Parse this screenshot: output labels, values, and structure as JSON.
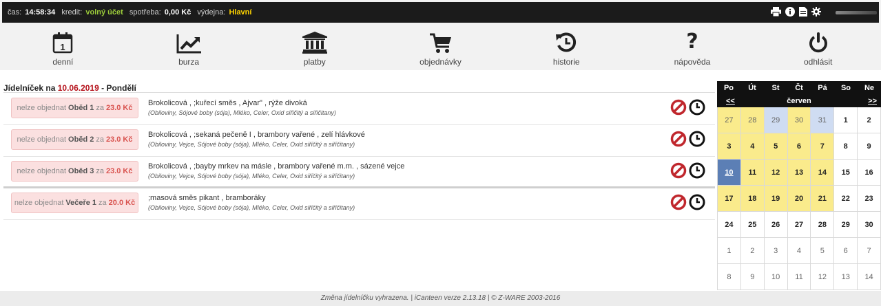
{
  "topbar": {
    "time_label": "čas:",
    "time_value": "14:58:34",
    "credit_label": "kredit:",
    "credit_value": "volný účet",
    "consumption_label": "spotřeba:",
    "consumption_value": "0,00 Kč",
    "canteen_label": "výdejna:",
    "canteen_value": "Hlavní",
    "icons": [
      "print-icon",
      "info-icon",
      "document-icon",
      "gear-icon"
    ]
  },
  "nav": {
    "items": [
      {
        "label": "denní",
        "icon": "calendar-icon",
        "day": "1"
      },
      {
        "label": "burza",
        "icon": "chart-icon"
      },
      {
        "label": "platby",
        "icon": "bank-icon"
      },
      {
        "label": "objednávky",
        "icon": "cart-icon"
      },
      {
        "label": "historie",
        "icon": "history-icon"
      },
      {
        "label": "nápověda",
        "icon": "question-icon",
        "glyph": "?"
      },
      {
        "label": "odhlásit",
        "icon": "power-icon"
      }
    ]
  },
  "menu": {
    "title_prefix": "Jídelníček na",
    "date": "10.06.2019",
    "day_suffix": "- Pondělí",
    "items": [
      {
        "prefix": "nelze objednat",
        "meal": "Oběd 1",
        "za": "za",
        "price": "23.0 Kč",
        "dish": "Brokolicová , ;kuřecí směs , Ajvar\" , rýže divoká",
        "allergens": "(Obiloviny, Sójové boby (sója), Mléko, Celer, Oxid siřičitý a siřičitany)"
      },
      {
        "prefix": "nelze objednat",
        "meal": "Oběd 2",
        "za": "za",
        "price": "23.0 Kč",
        "dish": "Brokolicová , ;sekaná pečeně I , brambory vařené , zelí hlávkové",
        "allergens": "(Obiloviny, Vejce, Sójové boby (sója), Mléko, Celer, Oxid siřičitý a siřičitany)"
      },
      {
        "prefix": "nelze objednat",
        "meal": "Oběd 3",
        "za": "za",
        "price": "23.0 Kč",
        "dish": "Brokolicová , ;bayby mrkev na másle , brambory vařené m.m. , sázené vejce",
        "allergens": "(Obiloviny, Vejce, Sójové boby (sója), Mléko, Celer, Oxid siřičitý a siřičitany)"
      },
      {
        "prefix": "nelze objednat",
        "meal": "Večeře 1",
        "za": "za",
        "price": "20.0 Kč",
        "dish": ";masová směs pikant , bramboráky",
        "allergens": "(Obiloviny, Vejce, Sójové boby (sója), Mléko, Celer, Oxid siřičitý a siřičitany)"
      }
    ]
  },
  "calendar": {
    "weekdays": [
      "Po",
      "Út",
      "St",
      "Čt",
      "Pá",
      "So",
      "Ne"
    ],
    "prev": "<<",
    "next": ">>",
    "month": "červen",
    "weeks": [
      [
        "27",
        "28",
        "29",
        "30",
        "31",
        "1",
        "2"
      ],
      [
        "3",
        "4",
        "5",
        "6",
        "7",
        "8",
        "9"
      ],
      [
        "10",
        "11",
        "12",
        "13",
        "14",
        "15",
        "16"
      ],
      [
        "17",
        "18",
        "19",
        "20",
        "21",
        "22",
        "23"
      ],
      [
        "24",
        "25",
        "26",
        "27",
        "28",
        "29",
        "30"
      ],
      [
        "1",
        "2",
        "3",
        "4",
        "5",
        "6",
        "7"
      ],
      [
        "8",
        "9",
        "10",
        "11",
        "12",
        "13",
        "14"
      ]
    ],
    "colors": {
      "yellow": "#faeb8c",
      "blue": "#cfdcf2",
      "today": "#5c7fb5"
    }
  },
  "footer": {
    "text": "Změna jídelníčku vyhrazena. | iCanteen verze 2.13.18 | © Z-WARE 2003-2016"
  },
  "colors": {
    "accent_red": "#b5121b",
    "price_red": "#d9534f",
    "credit_green": "#9ccc3a",
    "canteen_yellow": "#ffd400"
  }
}
